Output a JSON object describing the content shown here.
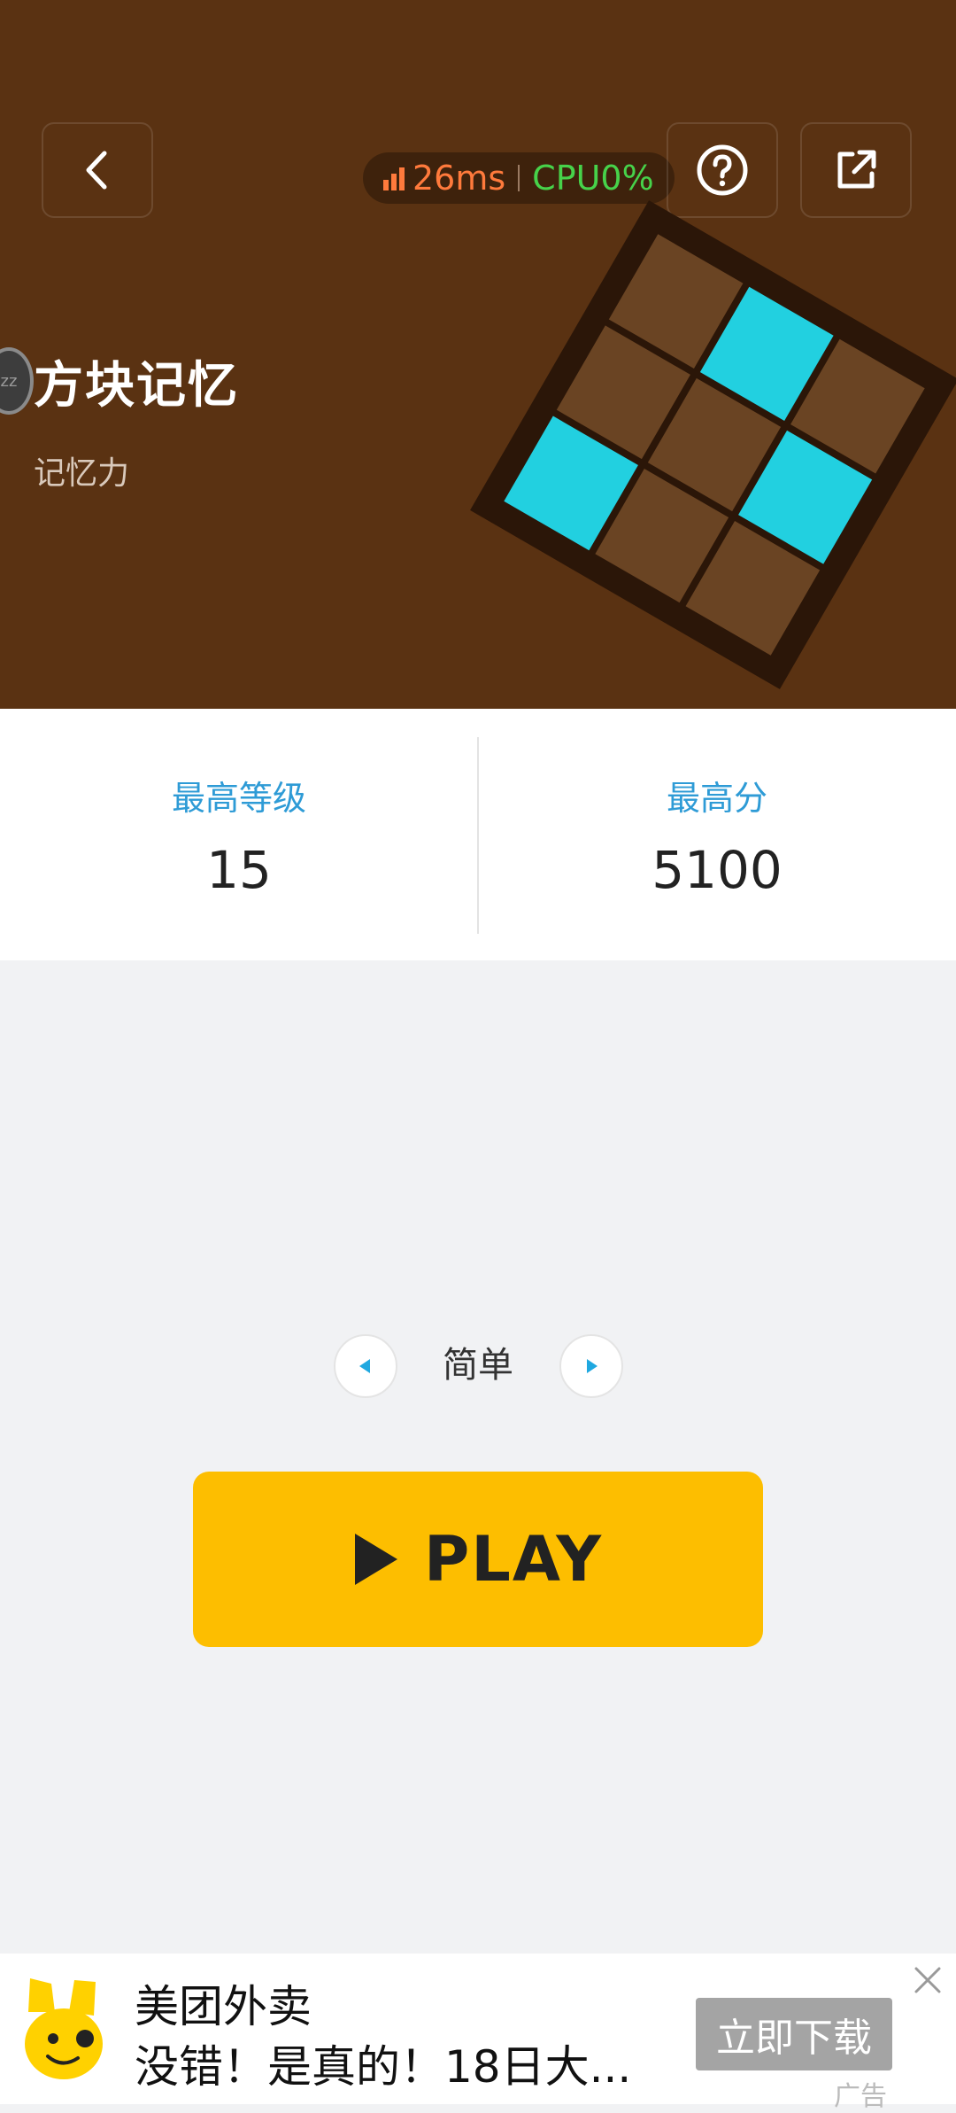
{
  "header": {
    "back_icon": "chevron-left-icon",
    "help_icon": "question-circle-icon",
    "share_icon": "external-link-icon",
    "latency": "26ms",
    "cpu": "CPU0%",
    "colors": {
      "bg": "#5A3212",
      "latency": "#FF7A3C",
      "cpu": "#47D24A"
    }
  },
  "game": {
    "title": "方块记忆",
    "category": "记忆力",
    "avatar_text": "zz",
    "tile_color": "#22D0E0"
  },
  "stats": [
    {
      "label": "最高等级",
      "value": "15"
    },
    {
      "label": "最高分",
      "value": "5100"
    }
  ],
  "difficulty": {
    "value": "简单",
    "prev_icon": "triangle-left-icon",
    "next_icon": "triangle-right-icon"
  },
  "play": {
    "label": "PLAY",
    "icon": "play-icon",
    "color": "#FDBE00"
  },
  "ad": {
    "title": "美团外卖",
    "text": "没错！是真的！18日大...",
    "button": "立即下载",
    "tag": "广告",
    "logo_icon": "meituan-kangaroo-icon"
  }
}
